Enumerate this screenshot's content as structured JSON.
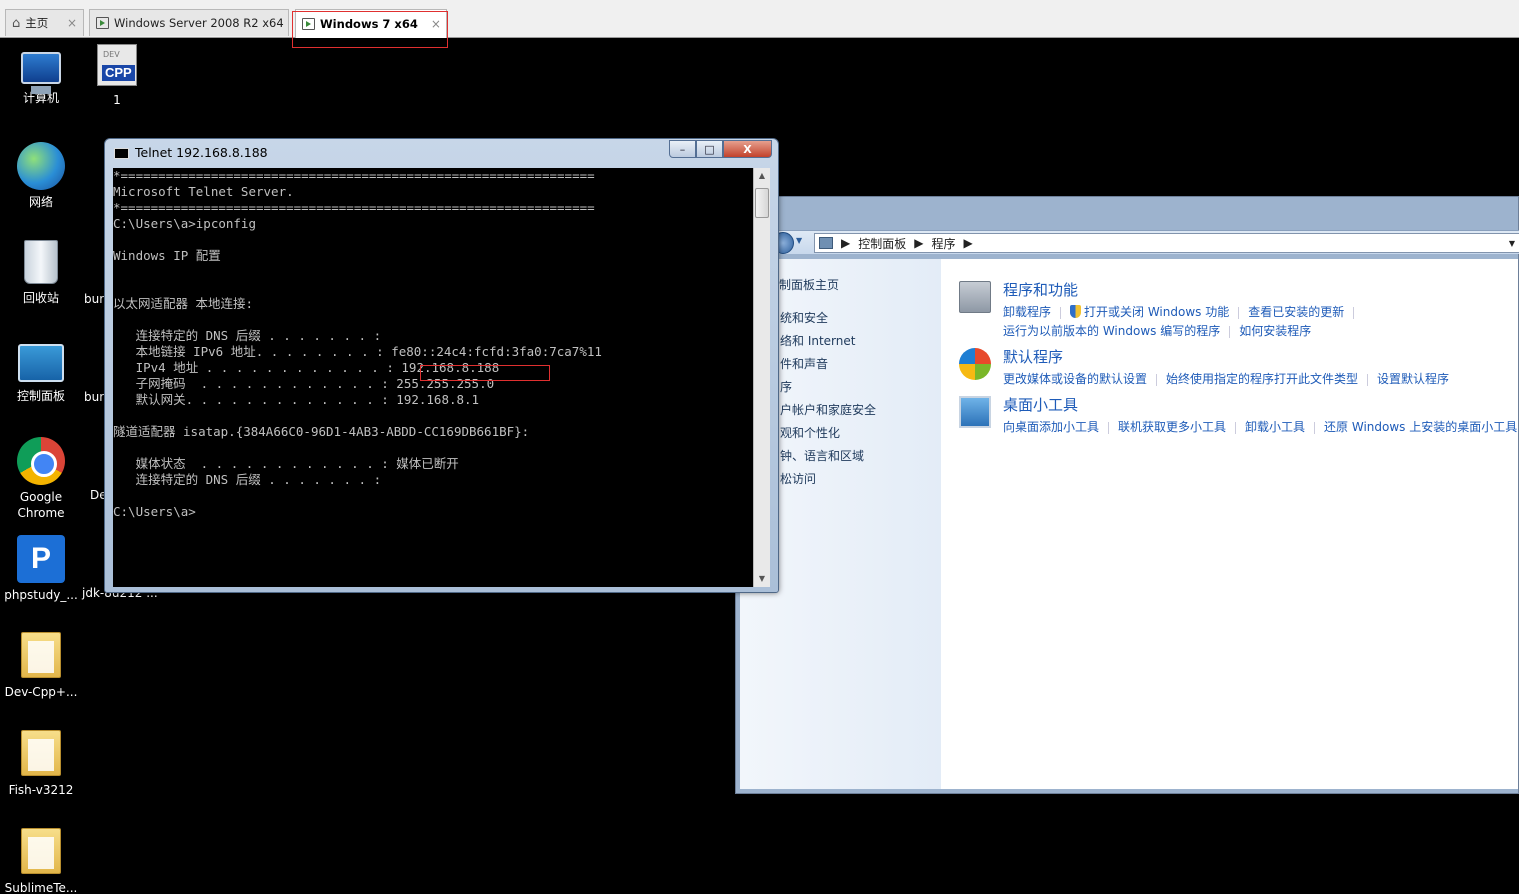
{
  "tabs": [
    {
      "label": "主页",
      "icon": "home-icon",
      "close": "×"
    },
    {
      "label": "Windows Server 2008 R2 x64",
      "icon": "vm-icon",
      "close": "×"
    },
    {
      "label": "Windows 7 x64",
      "icon": "vm-icon",
      "close": "×",
      "active": true
    }
  ],
  "desktop_icons": [
    {
      "label": "计算机",
      "icon": "computer-icon"
    },
    {
      "label": "1",
      "icon": "devcpp-file-icon",
      "badge": "CPP",
      "badge_top": "DEV"
    },
    {
      "label": "网络",
      "icon": "network-icon"
    },
    {
      "label": "回收站",
      "icon": "recycle-bin-icon"
    },
    {
      "label": "控制面板",
      "icon": "control-panel-icon"
    },
    {
      "label": "Google Chrome",
      "icon": "chrome-icon"
    },
    {
      "label": "phpstudy_...",
      "icon": "phpstudy-icon",
      "glyph": "P"
    },
    {
      "label": "Dev-Cpp+...",
      "icon": "folder-icon"
    },
    {
      "label": "Fish-v3212",
      "icon": "folder-icon"
    },
    {
      "label": "SublimeTe...",
      "icon": "folder-icon"
    }
  ],
  "partial_labels": [
    "bur",
    "bur",
    "De",
    "jdk-8u212 ..."
  ],
  "console": {
    "title": "Telnet 192.168.8.188",
    "buttons": {
      "minimize": "–",
      "maximize": "□",
      "close": "X"
    },
    "lines": [
      "*===============================================================",
      "Microsoft Telnet Server.",
      "*===============================================================",
      "C:\\Users\\a>ipconfig",
      "",
      "Windows IP 配置",
      "",
      "",
      "以太网适配器 本地连接:",
      "",
      "   连接特定的 DNS 后缀 . . . . . . . :",
      "   本地链接 IPv6 地址. . . . . . . . : fe80::24c4:fcfd:3fa0:7ca7%11",
      "   IPv4 地址 . . . . . . . . . . . . : 192.168.8.188",
      "   子网掩码  . . . . . . . . . . . . : 255.255.255.0",
      "   默认网关. . . . . . . . . . . . . : 192.168.8.1",
      "",
      "隧道适配器 isatap.{384A66C0-96D1-4AB3-ABDD-CC169DB661BF}:",
      "",
      "   媒体状态  . . . . . . . . . . . . : 媒体已断开",
      "   连接特定的 DNS 后缀 . . . . . . . :",
      "",
      "C:\\Users\\a>"
    ],
    "highlighted_value": "192.168.8.188"
  },
  "explorer": {
    "breadcrumb": [
      "控制面板",
      "程序"
    ],
    "nav": [
      "制面板主页",
      "统和安全",
      "络和 Internet",
      "件和声音",
      "序",
      "户帐户和家庭安全",
      "观和个性化",
      "钟、语言和区域",
      "松访问"
    ],
    "categories": [
      {
        "title": "程序和功能",
        "icon": "programs-features-icon",
        "links": [
          [
            "卸载程序",
            "打开或关闭 Windows 功能",
            "查看已安装的更新"
          ],
          [
            "运行为以前版本的 Windows 编写的程序",
            "如何安装程序"
          ]
        ]
      },
      {
        "title": "默认程序",
        "icon": "default-programs-icon",
        "links": [
          [
            "更改媒体或设备的默认设置",
            "始终使用指定的程序打开此文件类型",
            "设置默认程序"
          ]
        ]
      },
      {
        "title": "桌面小工具",
        "icon": "desktop-gadgets-icon",
        "links": [
          [
            "向桌面添加小工具",
            "联机获取更多小工具",
            "卸载小工具",
            "还原 Windows 上安装的桌面小工具"
          ]
        ]
      }
    ]
  },
  "colors": {
    "link": "#1e5bb8",
    "highlight_box": "#e03030",
    "console_bg": "#000000",
    "console_fg": "#c0c0c0"
  }
}
